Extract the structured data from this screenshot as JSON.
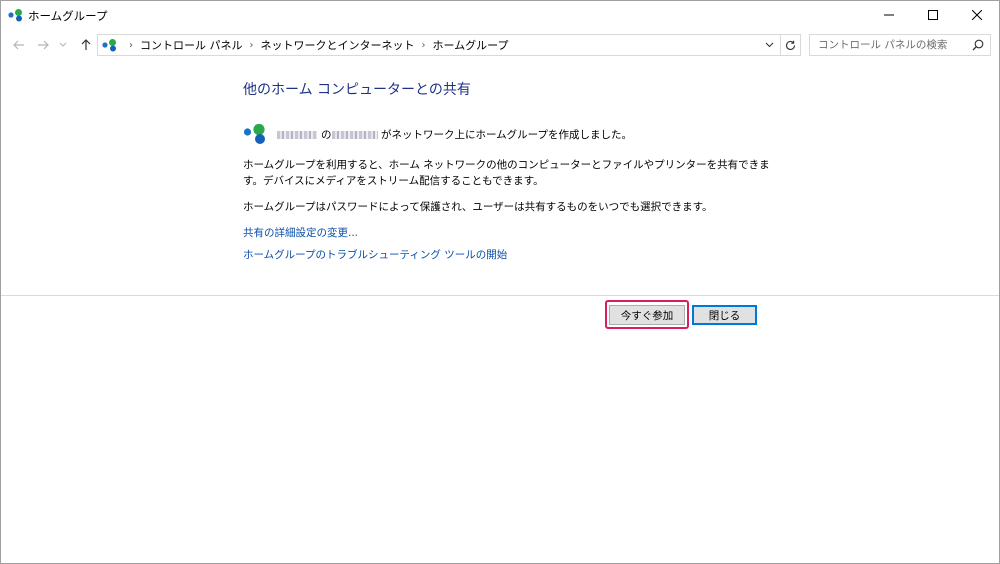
{
  "window": {
    "title": "ホームグループ",
    "controls": {
      "minimize": "minimize-icon",
      "maximize": "maximize-icon",
      "close": "close-icon"
    }
  },
  "navigation": {
    "breadcrumbs": [
      "コントロール パネル",
      "ネットワークとインターネット",
      "ホームグループ"
    ],
    "search_placeholder": "コントロール パネルの検索"
  },
  "content": {
    "heading": "他のホーム コンピューターとの共有",
    "created_no": "の",
    "created_message": "がネットワーク上にホームグループを作成しました。",
    "description1": "ホームグループを利用すると、ホーム ネットワークの他のコンピューターとファイルやプリンターを共有できます。デバイスにメディアをストリーム配信することもできます。",
    "description2": "ホームグループはパスワードによって保護され、ユーザーは共有するものをいつでも選択できます。",
    "links": {
      "advanced_sharing": "共有の詳細設定の変更...",
      "troubleshooter": "ホームグループのトラブルシューティング ツールの開始"
    }
  },
  "buttons": {
    "join_now": "今すぐ参加",
    "close": "閉じる"
  },
  "colors": {
    "heading": "#1e3287",
    "link": "#0a4ea8",
    "highlight": "#d81e5b",
    "default_button_border": "#0078d7"
  }
}
